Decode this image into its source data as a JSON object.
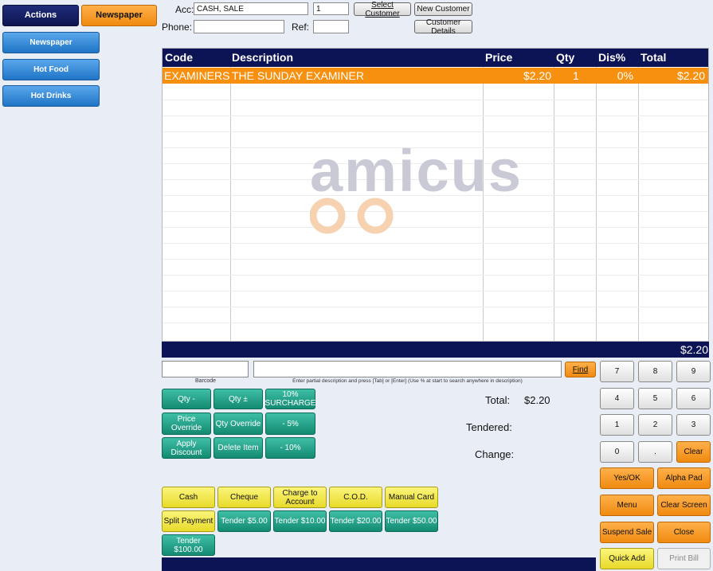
{
  "categories": {
    "actions": "Actions",
    "newspaper_tab": "Newspaper",
    "newspaper": "Newspaper",
    "hot_food": "Hot Food",
    "hot_drinks": "Hot Drinks"
  },
  "customer": {
    "acc_label": "Acc:",
    "acc_value": "CASH, SALE",
    "acc_num": "1",
    "phone_label": "Phone:",
    "phone_value": "",
    "ref_label": "Ref:",
    "ref_value": "",
    "select_customer": "Select Customer",
    "new_customer": "New Customer",
    "customer_details": "Customer Details"
  },
  "grid": {
    "headers": {
      "code": "Code",
      "description": "Description",
      "price": "Price",
      "qty": "Qty",
      "dis": "Dis%",
      "total": "Total"
    },
    "rows": [
      {
        "code": "EXAMINERS",
        "description": "THE SUNDAY EXAMINER",
        "price": "$2.20",
        "qty": "1",
        "dis": "0%",
        "total": "$2.20"
      }
    ],
    "footer_total": "$2.20",
    "watermark_text": "amicus"
  },
  "search": {
    "barcode_label": "Barcode",
    "hint": "Enter partial description and press [Tab] or [Enter] (Use % at start to search anywhere in description)",
    "find": "Find"
  },
  "item_actions": {
    "qty_minus": "Qty -",
    "qty_plusminus": "Qty ±",
    "surcharge": "10% SURCHARGE",
    "price_override": "Price Override",
    "qty_override": "Qty Override",
    "minus5": "- 5%",
    "apply_discount": "Apply Discount",
    "delete_item": "Delete Item",
    "minus10": "- 10%"
  },
  "totals": {
    "total_label": "Total:",
    "total_value": "$2.20",
    "tendered_label": "Tendered:",
    "change_label": "Change:"
  },
  "payments": {
    "cash": "Cash",
    "cheque": "Cheque",
    "charge_to_account": "Charge to Account",
    "cod": "C.O.D.",
    "manual_card": "Manual Card",
    "split_payment": "Split Payment",
    "tender5": "Tender $5.00",
    "tender10": "Tender $10.00",
    "tender20": "Tender $20.00",
    "tender50": "Tender $50.00",
    "tender100": "Tender $100.00"
  },
  "keypad": {
    "k7": "7",
    "k8": "8",
    "k9": "9",
    "k4": "4",
    "k5": "5",
    "k6": "6",
    "k1": "1",
    "k2": "2",
    "k3": "3",
    "k0": "0",
    "kdot": ".",
    "clear": "Clear",
    "yes_ok": "Yes/OK",
    "alpha_pad": "Alpha Pad",
    "menu": "Menu",
    "clear_screen": "Clear Screen",
    "suspend_sale": "Suspend Sale",
    "close": "Close",
    "quick_add": "Quick Add",
    "print_bill": "Print Bill"
  }
}
